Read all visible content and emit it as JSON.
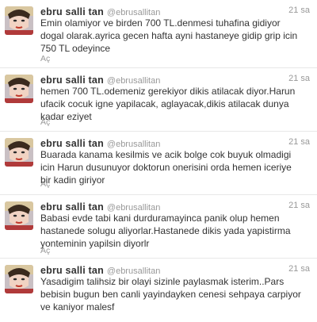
{
  "tweets": [
    {
      "name": "ebru salli tan",
      "handle": "@ebrusallitan",
      "time": "21 sa",
      "text": "Emin olamiyor ve birden 700 TL.denmesi tuhafina gidiyor dogal olarak.ayrica gecen hafta ayni hastaneye gidip grip icin 750 TL odeyince",
      "expand": "Aç"
    },
    {
      "name": "ebru salli tan",
      "handle": "@ebrusallitan",
      "time": "21 sa",
      "text": "hemen 700 TL.odemeniz gerekiyor dikis atilacak diyor.Harun ufacik cocuk igne yapilacak, aglayacak,dikis atilacak dunya kadar eziyet",
      "expand": "Aç"
    },
    {
      "name": "ebru salli tan",
      "handle": "@ebrusallitan",
      "time": "21 sa",
      "text": "Buarada kanama kesilmis ve acik bolge cok buyuk olmadigi icin Harun dusunuyor doktorun onerisini orda hemen iceriye bir kadin giriyor",
      "expand": "Aç"
    },
    {
      "name": "ebru salli tan",
      "handle": "@ebrusallitan",
      "time": "21 sa",
      "text": "Babasi evde tabi kani durduramayinca panik olup hemen hastanede solugu aliyorlar.Hastanede dikis yada yapistirma yonteminin yapilsin diyorlr",
      "expand": "Aç"
    },
    {
      "name": "ebru salli tan",
      "handle": "@ebrusallitan",
      "time": "21 sa",
      "text": "Yasadigim talihsiz bir olayi sizinle paylasmak isterim..Pars bebisin bugun ben canli yayindayken cenesi sehpaya carpiyor ve kaniyor malesf",
      "expand": ""
    }
  ],
  "colors": {
    "text": "#333333",
    "meta": "#999999",
    "divider": "#e8e8e8"
  },
  "icons": {
    "avatar": "profile-photo"
  }
}
